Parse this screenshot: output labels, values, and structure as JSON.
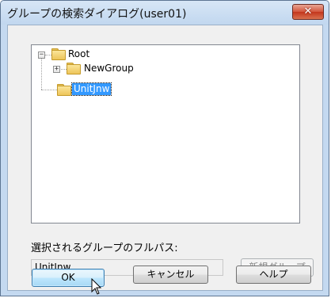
{
  "window": {
    "title": "グループの検索ダイアログ(user01)",
    "close_glyph": "✕"
  },
  "tree": {
    "nodes": [
      {
        "label": "Root",
        "expander": "⊟",
        "level": 0,
        "selected": false
      },
      {
        "label": "NewGroup",
        "expander": "⊞",
        "level": 1,
        "selected": false
      },
      {
        "label": "UnitJnw",
        "expander": "",
        "level": 1,
        "selected": true
      }
    ]
  },
  "fullpath": {
    "caption": "選択されるグループのフルパス:",
    "value": "UnitJnw"
  },
  "buttons": {
    "new_group": "新規グループ",
    "ok": "OK",
    "cancel": "キャンセル",
    "help": "ヘルプ"
  },
  "colors": {
    "selection": "#3399ff",
    "close_button": "#c3361c",
    "titlebar": "#c4d9f0"
  }
}
